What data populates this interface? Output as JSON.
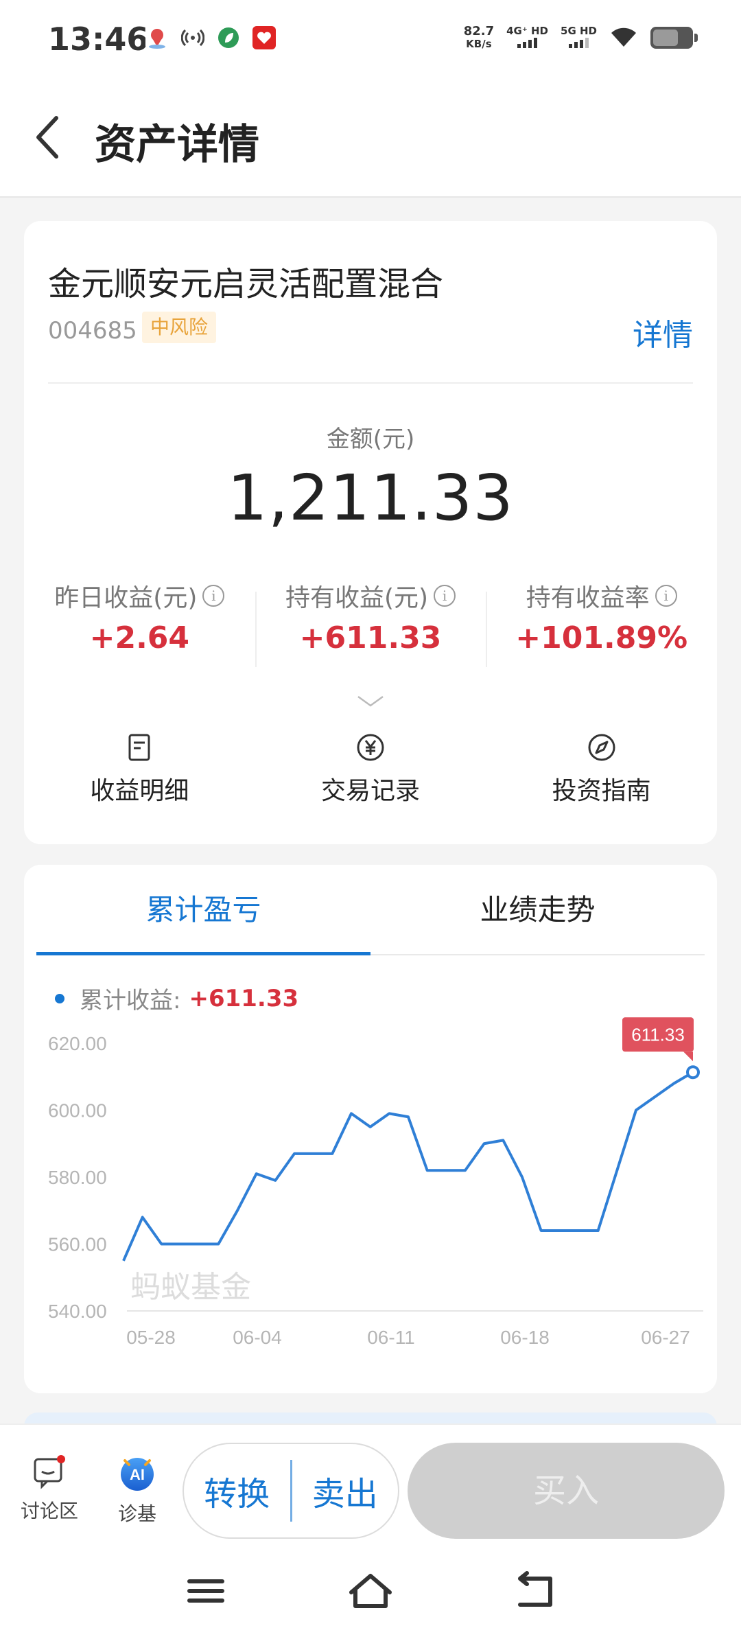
{
  "status": {
    "time": "13:46",
    "net_speed_value": "82.7",
    "net_speed_unit": "KB/s",
    "sig1": "4G⁺ HD",
    "sig2": "5G HD"
  },
  "header": {
    "title": "资产详情"
  },
  "fund": {
    "name": "金元顺安元启灵活配置混合",
    "code": "004685",
    "risk": "中风险",
    "detail_link": "详情",
    "amount_label": "金额(元)",
    "amount": "1,211.33"
  },
  "stats": [
    {
      "label": "昨日收益(元)",
      "value": "+2.64"
    },
    {
      "label": "持有收益(元)",
      "value": "+611.33"
    },
    {
      "label": "持有收益率",
      "value": "+101.89%"
    }
  ],
  "actions": [
    {
      "label": "收益明细",
      "icon": "document-icon"
    },
    {
      "label": "交易记录",
      "icon": "yuan-circle-icon"
    },
    {
      "label": "投资指南",
      "icon": "compass-icon"
    }
  ],
  "tabs": [
    {
      "label": "累计盈亏",
      "active": true
    },
    {
      "label": "业绩走势",
      "active": false
    }
  ],
  "legend": {
    "label": "累计收益:",
    "value": "+611.33"
  },
  "chart_data": {
    "type": "line",
    "watermark": "蚂蚁基金",
    "x_ticks": [
      "05-28",
      "06-04",
      "06-11",
      "06-18",
      "06-27"
    ],
    "y_ticks": [
      "620.00",
      "600.00",
      "580.00",
      "560.00",
      "540.00"
    ],
    "ylim": [
      540,
      620
    ],
    "series": [
      {
        "color": "#2f7fd6",
        "values": [
          555,
          568,
          560,
          560,
          560,
          560,
          570,
          581,
          579,
          587,
          587,
          587,
          599,
          595,
          599,
          598,
          582,
          582,
          582,
          590,
          591,
          580,
          564,
          564,
          564,
          564,
          582,
          600,
          604,
          608,
          611.33
        ]
      }
    ],
    "last_point_label": "611.33",
    "accent": "#e0525e"
  },
  "bottom": {
    "discuss": "讨论区",
    "diagnose": "诊基",
    "convert": "转换",
    "sell": "卖出",
    "buy": "买入"
  }
}
